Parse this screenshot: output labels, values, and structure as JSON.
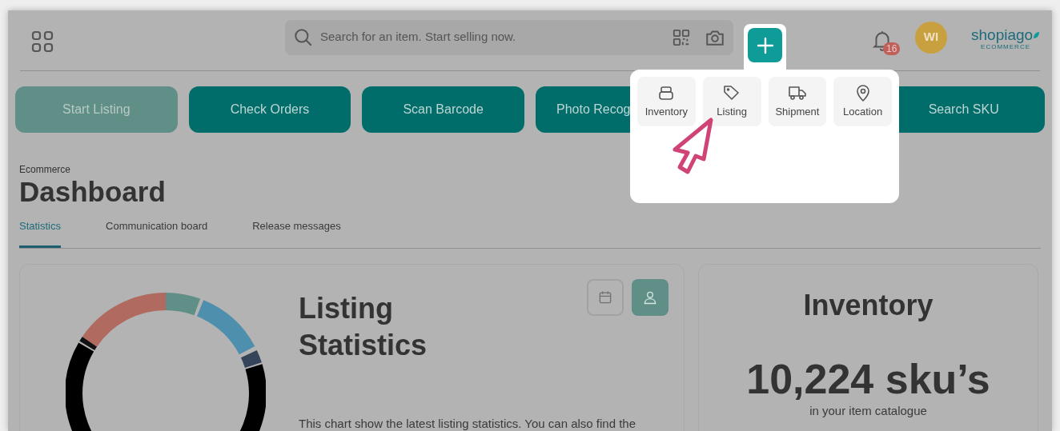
{
  "header": {
    "search": {
      "placeholder": "Search for an item. Start selling now."
    },
    "add_menu": {
      "expanded": true,
      "items": [
        {
          "label": "Inventory",
          "kind": "stack"
        },
        {
          "label": "Listing",
          "kind": "tag"
        },
        {
          "label": "Shipment",
          "kind": "truck"
        },
        {
          "label": "Location",
          "kind": "pin"
        }
      ]
    },
    "notifications": {
      "count": "16"
    },
    "avatar": {
      "initials": "WI"
    },
    "logo": {
      "name": "shopiago",
      "tagline": "ECOMMERCE"
    }
  },
  "quick_actions": [
    {
      "label": "Start Listing",
      "disabled": true
    },
    {
      "label": "Check Orders",
      "disabled": false
    },
    {
      "label": "Scan Barcode",
      "disabled": false
    },
    {
      "label": "Photo Recog",
      "disabled": false
    },
    {
      "label": "Search SKU",
      "disabled": false
    }
  ],
  "breadcrumb": "Ecommerce",
  "title": "Dashboard",
  "tabs": [
    {
      "label": "Statistics",
      "selected": true
    },
    {
      "label": "Communication board",
      "selected": false
    },
    {
      "label": "Release messages",
      "selected": false
    }
  ],
  "listing_card": {
    "title": "Listing Statistics",
    "view_toggle": [
      {
        "kind": "calendar",
        "selected": false
      },
      {
        "kind": "person",
        "selected": true
      }
    ],
    "description": "This chart show the latest listing statistics. You can also find the"
  },
  "inventory_card": {
    "title": "Inventory",
    "count": "10,224 sku’s",
    "caption": "in your item catalogue"
  }
}
